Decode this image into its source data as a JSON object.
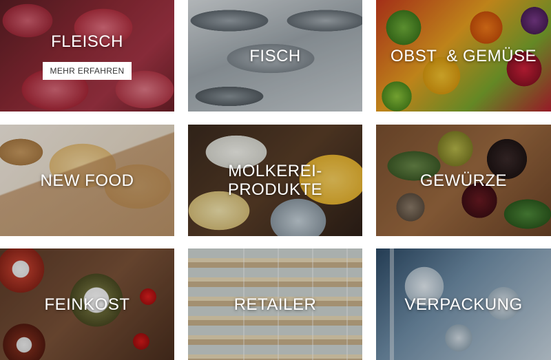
{
  "tiles": [
    {
      "label": "FLEISCH",
      "button": "MEHR ERFAHREN"
    },
    {
      "label": "FISCH"
    },
    {
      "label": "OBST  & GEMÜSE"
    },
    {
      "label": "NEW FOOD"
    },
    {
      "label": "MOLKEREI-\nPRODUKTE"
    },
    {
      "label": "GEWÜRZE"
    },
    {
      "label": "FEINKOST"
    },
    {
      "label": "RETAILER"
    },
    {
      "label": "VERPACKUNG"
    }
  ],
  "colors": {
    "label_text": "#ffffff",
    "button_bg": "#ffffff",
    "button_text": "#333333",
    "page_bg": "#ffffff"
  }
}
